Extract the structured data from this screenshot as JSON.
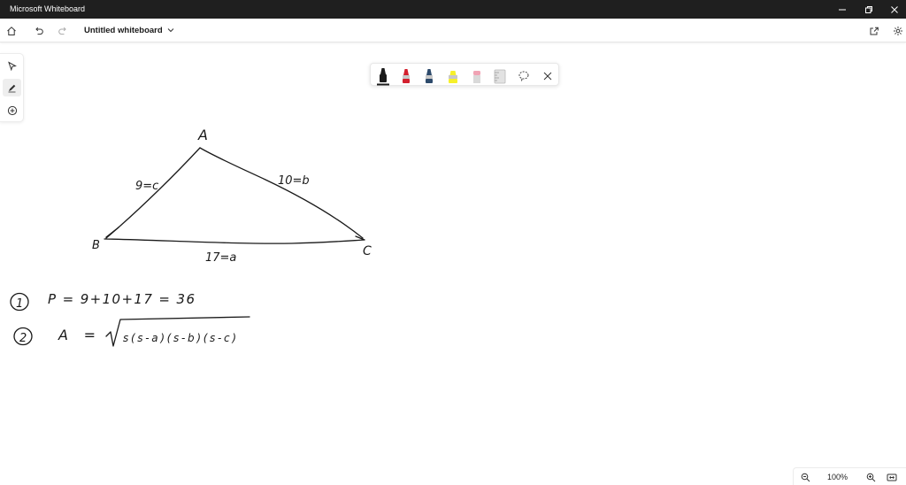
{
  "window": {
    "title": "Microsoft Whiteboard",
    "controls": [
      "minimize-icon",
      "restore-icon",
      "close-icon"
    ]
  },
  "appbar": {
    "board_title": "Untitled whiteboard",
    "left_icons": [
      "home-icon",
      "undo-icon",
      "redo-icon"
    ],
    "right_icons": [
      "share-icon",
      "settings-icon"
    ]
  },
  "left_toolbar": {
    "tools": [
      "select-icon",
      "ink-icon",
      "add-icon"
    ],
    "active": "ink-icon"
  },
  "pen_tray": {
    "tools": [
      {
        "name": "black-pen",
        "color": "#1a1a1a",
        "selected": true
      },
      {
        "name": "red-pen",
        "color": "#d3202e"
      },
      {
        "name": "blue-pen",
        "color": "#2d4a6b"
      },
      {
        "name": "yellow-highlighter",
        "color": "#f6f02a"
      },
      {
        "name": "eraser",
        "color": "#f0a3b4"
      },
      {
        "name": "ruler",
        "color": "#d6d6d6"
      },
      {
        "name": "lasso",
        "color": "#444444"
      }
    ],
    "close": "close-icon"
  },
  "drawing": {
    "vertex_a": "A",
    "vertex_b": "B",
    "vertex_c": "C",
    "side_c": "9=c",
    "side_b": "10=b",
    "side_a": "17=a",
    "step1_num": "1",
    "step1": "P = 9+10+17 = 36",
    "step2_num": "2",
    "step2_lhs": "A =",
    "step2_radicand": "s(s-a)(s-b)(s-c)"
  },
  "zoom": {
    "value": "100%"
  }
}
